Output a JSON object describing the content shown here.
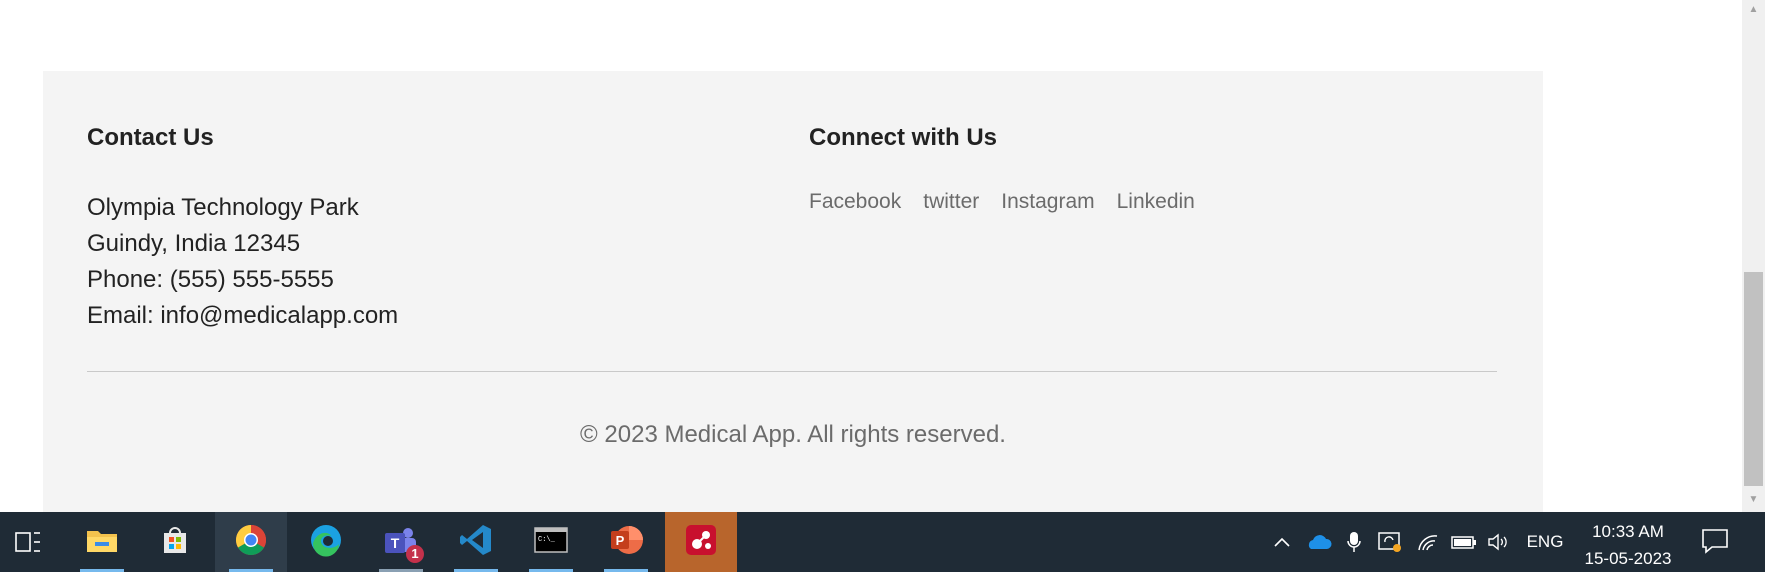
{
  "footer": {
    "contact": {
      "title": "Contact Us",
      "address_line1": "Olympia Technology Park",
      "address_line2": "Guindy, India 12345",
      "phone": "Phone: (555) 555-5555",
      "email": "Email: info@medicalapp.com"
    },
    "connect": {
      "title": "Connect with Us",
      "links": [
        "Facebook",
        "twitter",
        "Instagram",
        "Linkedin"
      ]
    },
    "copyright": "© 2023 Medical App. All rights reserved."
  },
  "taskbar": {
    "apps": [
      "File Explorer",
      "Microsoft Store",
      "Google Chrome",
      "Microsoft Edge",
      "Microsoft Teams",
      "Visual Studio Code",
      "Command Prompt",
      "PowerPoint",
      "App"
    ],
    "teams_badge": "1",
    "language": "ENG",
    "time": "10:33 AM",
    "date": "15-05-2023"
  },
  "colors": {
    "footer_bg": "#f4f4f4",
    "taskbar_bg": "#1f2b36",
    "accent": "#76b9ed"
  }
}
